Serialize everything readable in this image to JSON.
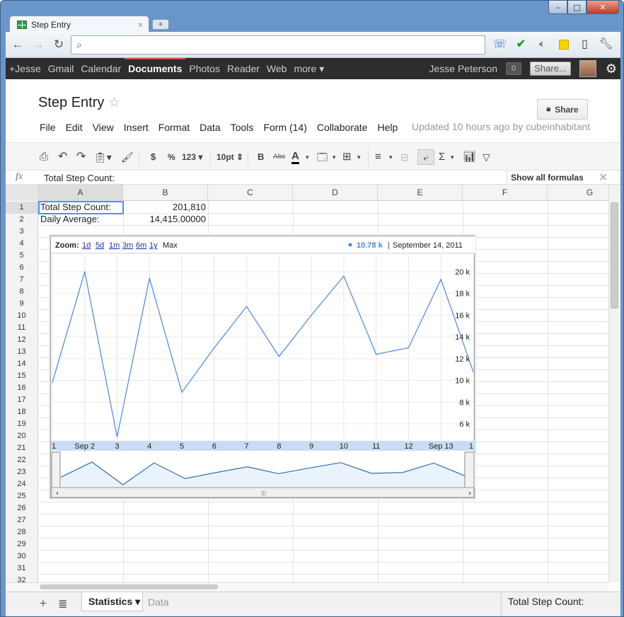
{
  "window": {
    "controls": [
      "–",
      "□",
      "✕"
    ]
  },
  "tab": {
    "title": "Step Entry",
    "close": "×",
    "new_tab": "+"
  },
  "omnibox": {
    "value": ""
  },
  "google_bar": {
    "links": [
      "+Jesse",
      "Gmail",
      "Calendar",
      "Documents",
      "Photos",
      "Reader",
      "Web",
      "more ▾"
    ],
    "active": "Documents",
    "user": "Jesse Peterson",
    "notification_count": "0",
    "share_label": "Share..."
  },
  "doc": {
    "title": "Step Entry",
    "share_label": "Share",
    "menus": [
      "File",
      "Edit",
      "View",
      "Insert",
      "Format",
      "Data",
      "Tools",
      "Form (14)",
      "Collaborate",
      "Help"
    ],
    "updated": "Updated 10 hours ago by cubeinhabitant"
  },
  "toolbar": {
    "currency": "$",
    "percent": "%",
    "number_format": "123 ▾",
    "font_size": "10pt ⇕",
    "bold": "B",
    "strike": "Abc",
    "text_color": "A"
  },
  "formula_bar": {
    "fx": "fx",
    "value": "Total Step Count:",
    "show_all": "Show all formulas",
    "close": "✕"
  },
  "grid": {
    "columns": [
      "A",
      "B",
      "C",
      "D",
      "E",
      "F",
      "G"
    ],
    "rows": [
      "1",
      "2",
      "3",
      "4",
      "5",
      "6",
      "7",
      "8",
      "9",
      "10",
      "11",
      "12",
      "13",
      "14",
      "15",
      "16",
      "17",
      "18",
      "19",
      "20",
      "21",
      "22",
      "23",
      "24",
      "25",
      "26",
      "27",
      "28",
      "29",
      "30",
      "31",
      "32"
    ],
    "cells": {
      "A1": "Total Step Count:",
      "B1": "201,810",
      "A2": "Daily Average:",
      "B2": "14,415.00000"
    }
  },
  "chart_data": {
    "type": "line",
    "zoom_label": "Zoom:",
    "zoom_options": [
      "1d",
      "5d",
      "1m",
      "3m",
      "6m",
      "1y",
      "Max"
    ],
    "readout_value": "10.78 k",
    "readout_date": "September 14, 2011",
    "x_tick_labels": [
      "1",
      "Sep 2",
      "3",
      "4",
      "5",
      "6",
      "7",
      "8",
      "9",
      "10",
      "11",
      "12",
      "Sep 13",
      "1"
    ],
    "x_tick_days": [
      1,
      2,
      3,
      4,
      5,
      6,
      7,
      8,
      9,
      10,
      11,
      12,
      13,
      14
    ],
    "y_tick_labels": [
      "20 k",
      "18 k",
      "16 k",
      "14 k",
      "12 k",
      "10 k",
      "8 k",
      "6 k"
    ],
    "y_ticks": [
      20000,
      18000,
      16000,
      14000,
      12000,
      10000,
      8000,
      6000
    ],
    "ylim": [
      4500,
      21500
    ],
    "series": [
      {
        "x": [
          1,
          2,
          3,
          4,
          5,
          6,
          7,
          8,
          9,
          10,
          11,
          12,
          13,
          14
        ],
        "values": [
          9800,
          20000,
          4800,
          19400,
          8900,
          13000,
          16800,
          12200,
          16000,
          19600,
          12400,
          13000,
          19300,
          10780
        ]
      }
    ],
    "line_color": "#4a86d8"
  },
  "sheets": {
    "tabs": [
      "Statistics ▾",
      "Data"
    ],
    "active": "Statistics ▾",
    "status": "Total Step Count:"
  }
}
